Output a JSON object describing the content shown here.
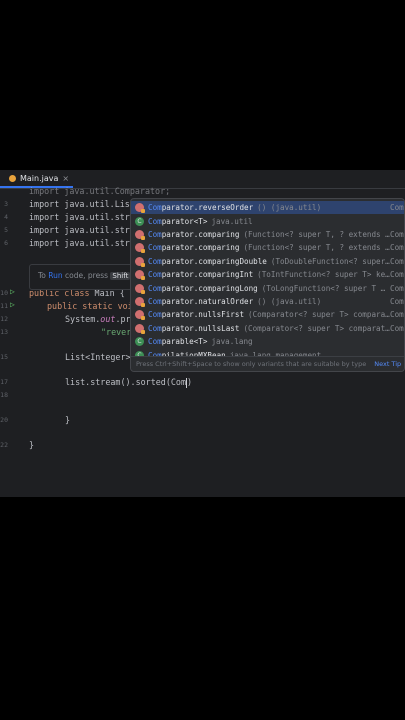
{
  "tab": {
    "label": "Main.java",
    "close": "×"
  },
  "lines": {
    "n3": "3",
    "n4": "4",
    "n5": "5",
    "n6": "6",
    "n10": "10",
    "n11": "11",
    "n12": "12",
    "n13": "13",
    "n15": "15",
    "n17": "17",
    "n18": "18",
    "n20": "20",
    "n22": "22"
  },
  "code": {
    "l2": "import java.util.Comparator;",
    "l3": "import java.util.List;",
    "l4": "import java.util.strea",
    "l5": "import java.util.strea",
    "l6": "import java.util.strea",
    "l10_kw": "public class",
    "l10_rest": " Main {",
    "l11_kw": "public static void",
    "l12_a": "System.",
    "l12_out": "out",
    "l12_b": ".pri",
    "l13_str": "\"rever",
    "l15": "List<Integer>",
    "l17_a": "list.stream().sorted(",
    "l17_b": "Com",
    "l17_c": ")",
    "l20": "}",
    "l22": "}"
  },
  "hint": {
    "pre": "To ",
    "link": "Run",
    "mid": " code, press ",
    "key": "Shift"
  },
  "completion": {
    "items": [
      {
        "icon": "method-icon",
        "prefix": "Com",
        "name": "parator.reverseOrder",
        "sig": "() (java.util)",
        "type": "Com"
      },
      {
        "icon": "class-icon",
        "prefix": "Com",
        "name": "parator<T>",
        "sig": "java.util",
        "type": ""
      },
      {
        "icon": "method-icon",
        "prefix": "Com",
        "name": "parator.comparing",
        "sig": "(Function<? super T, ? extends …",
        "type": "Com"
      },
      {
        "icon": "method-icon",
        "prefix": "Com",
        "name": "parator.comparing",
        "sig": "(Function<? super T, ? extends …",
        "type": "Com"
      },
      {
        "icon": "method-icon",
        "prefix": "Com",
        "name": "parator.comparingDouble",
        "sig": "(ToDoubleFunction<? super…",
        "type": "Com"
      },
      {
        "icon": "method-icon",
        "prefix": "Com",
        "name": "parator.comparingInt",
        "sig": "(ToIntFunction<? super T> ke…",
        "type": "Com"
      },
      {
        "icon": "method-icon",
        "prefix": "Com",
        "name": "parator.comparingLong",
        "sig": "(ToLongFunction<? super T …",
        "type": "Com"
      },
      {
        "icon": "method-icon",
        "prefix": "Com",
        "name": "parator.naturalOrder",
        "sig": "() (java.util)",
        "type": "Com"
      },
      {
        "icon": "method-icon",
        "prefix": "Com",
        "name": "parator.nullsFirst",
        "sig": "(Comparator<? super T> compara…",
        "type": "Com"
      },
      {
        "icon": "method-icon",
        "prefix": "Com",
        "name": "parator.nullsLast",
        "sig": "(Comparator<? super T> comparat…",
        "type": "Com"
      },
      {
        "icon": "class-icon",
        "prefix": "Com",
        "name": "parable<T>",
        "sig": "java.lang",
        "type": ""
      },
      {
        "icon": "class-icon",
        "prefix": "Com",
        "name": "pilationMXBean",
        "sig": "java.lang.management",
        "type": ""
      }
    ],
    "footer": "Press Ctrl+Shift+Space to show only variants that are suitable by type",
    "footer_link": "Next Tip"
  }
}
